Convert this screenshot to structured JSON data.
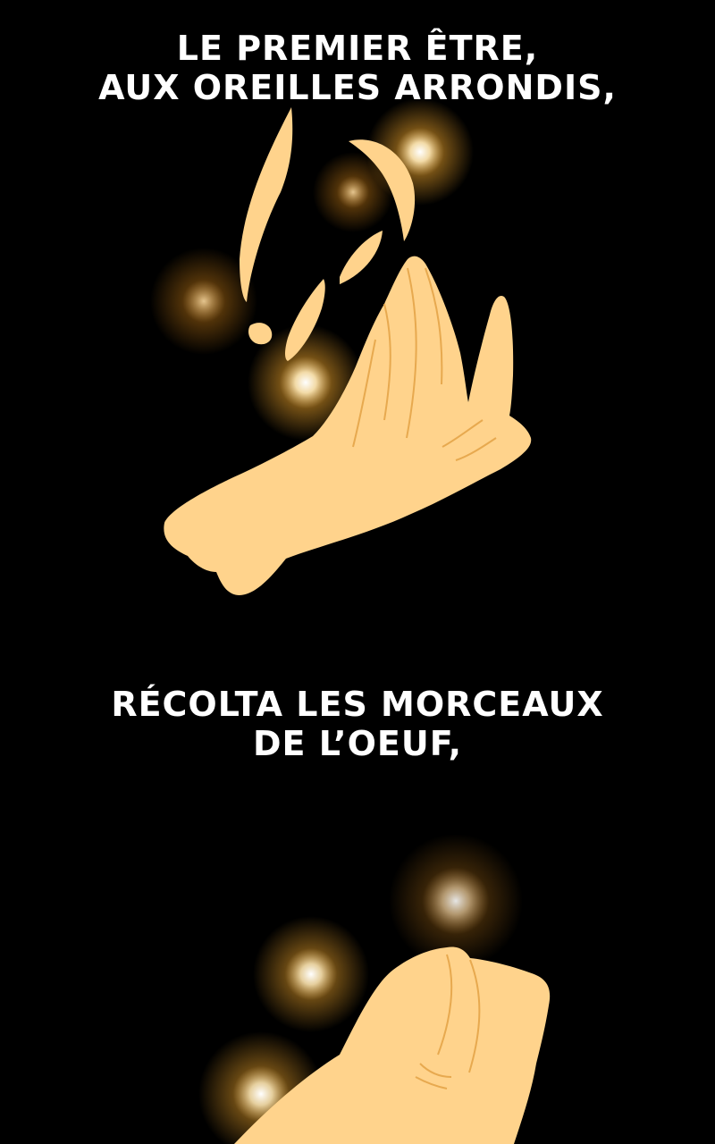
{
  "panels": [
    {
      "caption_lines": [
        "LE PREMIER ÊTRE,",
        "AUX OREILLES ARRONDIS,"
      ]
    },
    {
      "caption_lines": [
        "RÉCOLTA LES MORCEAUX",
        "DE L’OEUF,"
      ]
    }
  ],
  "colors": {
    "background": "#000000",
    "skin": "#ffd38c",
    "skin_line": "#e7a94f",
    "glow": "#ffb02e",
    "glow_core": "#ffffff",
    "text": "#ffffff"
  },
  "icons": [
    "glow-orb",
    "hand",
    "egg-shell-fragment"
  ]
}
